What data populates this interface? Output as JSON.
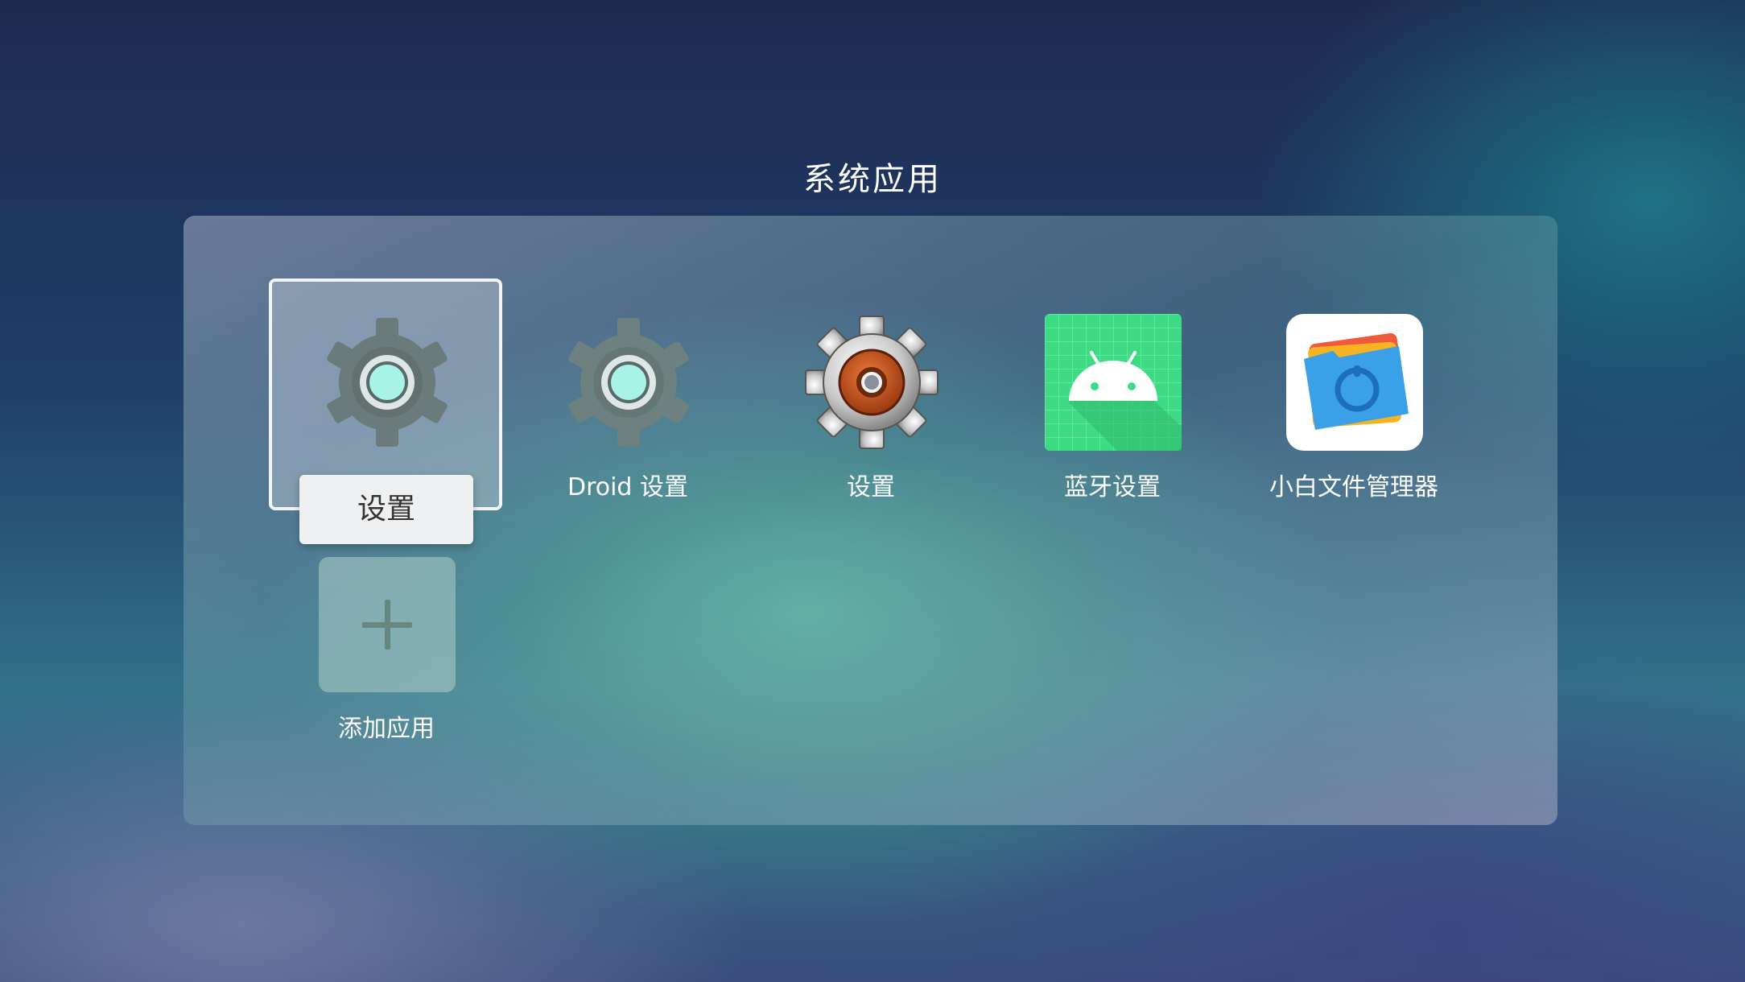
{
  "page": {
    "title": "系统应用"
  },
  "apps": [
    {
      "label": "设置",
      "icon": "gear-teal-icon",
      "focused": true
    },
    {
      "label": "Droid 设置",
      "icon": "gear-teal-icon"
    },
    {
      "label": "设置",
      "icon": "gear-orange-icon"
    },
    {
      "label": "蓝牙设置",
      "icon": "android-robot-icon"
    },
    {
      "label": "小白文件管理器",
      "icon": "folder-icon"
    }
  ],
  "add_app": {
    "label": "添加应用",
    "icon": "plus-icon"
  },
  "colors": {
    "accent_teal": "#a9f2e6",
    "android_green": "#3ddc84",
    "folder_blue": "#3aa0e8",
    "gear_orange": "#c5521b"
  }
}
